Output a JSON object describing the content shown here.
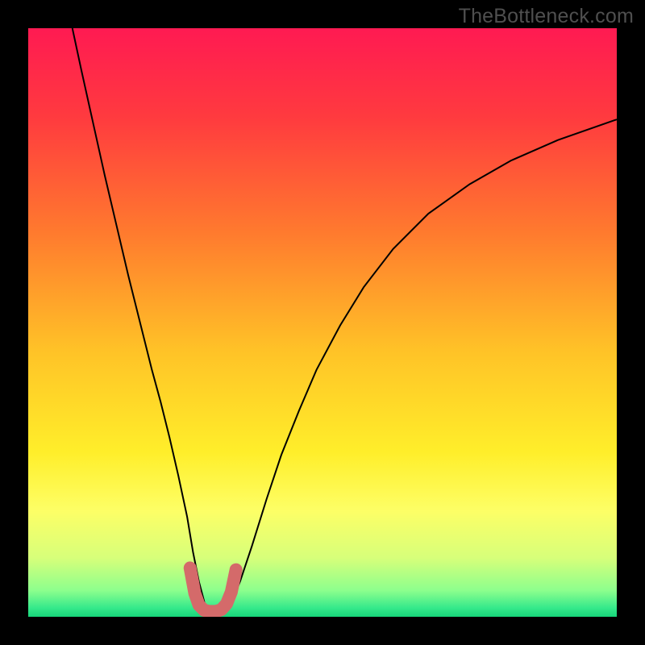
{
  "watermark": "TheBottleneck.com",
  "chart_data": {
    "type": "line",
    "title": "",
    "xlabel": "",
    "ylabel": "",
    "xlim": [
      0,
      100
    ],
    "ylim": [
      0,
      100
    ],
    "background_gradient": {
      "stops": [
        {
          "offset": 0.0,
          "color": "#ff1a52"
        },
        {
          "offset": 0.15,
          "color": "#ff3a3f"
        },
        {
          "offset": 0.35,
          "color": "#ff7b2e"
        },
        {
          "offset": 0.55,
          "color": "#ffc327"
        },
        {
          "offset": 0.72,
          "color": "#ffee2a"
        },
        {
          "offset": 0.82,
          "color": "#fdff66"
        },
        {
          "offset": 0.9,
          "color": "#d7ff7a"
        },
        {
          "offset": 0.955,
          "color": "#8dff8d"
        },
        {
          "offset": 0.985,
          "color": "#35e98b"
        },
        {
          "offset": 1.0,
          "color": "#17d57a"
        }
      ]
    },
    "series": [
      {
        "name": "bottleneck-curve",
        "color": "#000000",
        "stroke_width": 2,
        "x": [
          7.5,
          9,
          11,
          13,
          15,
          17,
          19,
          21,
          22.5,
          24,
          25.5,
          27,
          28,
          29,
          30,
          31.5,
          33,
          34.5,
          36,
          38,
          40.5,
          43,
          46,
          49,
          53,
          57,
          62,
          68,
          75,
          82,
          90,
          100
        ],
        "y": [
          100,
          93,
          84,
          75,
          66.5,
          58,
          50,
          42,
          36.5,
          30.5,
          24,
          17,
          11,
          6,
          2.2,
          0.8,
          0.8,
          2.4,
          6,
          12,
          20,
          27.5,
          35,
          42,
          49.5,
          56,
          62.5,
          68.5,
          73.5,
          77.5,
          81,
          84.5
        ]
      },
      {
        "name": "optimal-region-highlight",
        "color": "#d46a6a",
        "stroke_width": 16,
        "linecap": "round",
        "x": [
          27.5,
          28.3,
          29.0,
          29.9,
          30.8,
          31.8,
          32.8,
          33.7,
          34.5,
          35.3
        ],
        "y": [
          8.3,
          4.0,
          2.0,
          1.1,
          0.9,
          0.9,
          1.2,
          2.2,
          4.2,
          8.0
        ]
      }
    ]
  }
}
